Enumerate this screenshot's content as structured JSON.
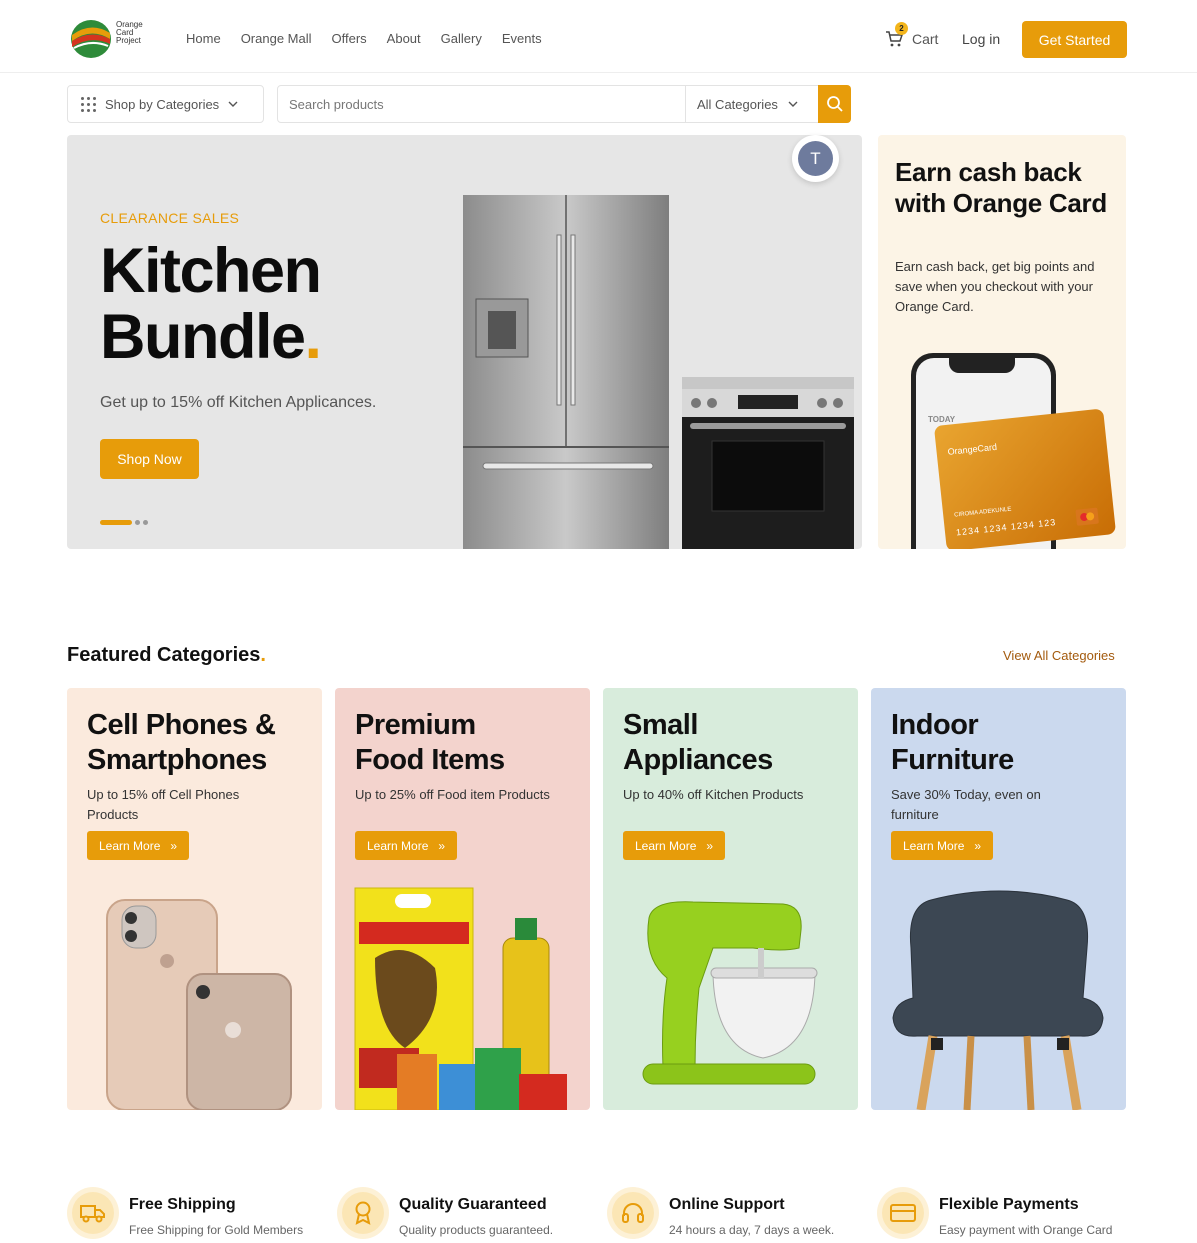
{
  "brand": {
    "logo_text": "Orange Card Project"
  },
  "nav": {
    "links": [
      "Home",
      "Orange Mall",
      "Offers",
      "About",
      "Gallery",
      "Events"
    ],
    "cart_label": "Cart",
    "cart_count": "2",
    "login_label": "Log in",
    "get_started_label": "Get Started"
  },
  "search": {
    "shop_by_categories": "Shop by Categories",
    "placeholder": "Search products",
    "category_select": "All Categories"
  },
  "hero": {
    "tag": "CLEARANCE SALES",
    "title_line1": "Kitchen",
    "title_line2": "Bundle",
    "title_dot": ".",
    "subtitle": "Get up to 15% off Kitchen Applicances.",
    "cta": "Shop Now",
    "avatar_initial": "T"
  },
  "promo": {
    "title": "Earn cash back with Orange Card",
    "text": "Earn cash back, get big points and save when you checkout with your Orange Card.",
    "card_brand": "OrangeCard",
    "card_holder": "CIROMA ADEKUNLE",
    "card_number": "1234 1234 1234 123",
    "phone_label": "TODAY"
  },
  "featured": {
    "title": "Featured Categories",
    "title_dot": ".",
    "view_all": "View All Categories",
    "learn_more": "Learn More",
    "categories": [
      {
        "title": "Cell Phones & Smartphones",
        "desc": "Up to 15% off Cell Phones Products",
        "bg": "#fbeadd"
      },
      {
        "title": "Premium Food Items",
        "desc": "Up to 25% off Food item Products",
        "bg": "#f3d3cd"
      },
      {
        "title": "Small Appliances",
        "desc": "Up to 40% off Kitchen Products",
        "bg": "#d8ecdc"
      },
      {
        "title": "Indoor Furniture",
        "desc": "Save 30% Today, even on furniture",
        "bg": "#cbd9ee"
      }
    ]
  },
  "features": [
    {
      "title": "Free Shipping",
      "sub": "Free Shipping for Gold Members",
      "icon": "truck-icon"
    },
    {
      "title": "Quality Guaranteed",
      "sub": "Quality products guaranteed.",
      "icon": "award-icon"
    },
    {
      "title": "Online Support",
      "sub": "24 hours a day, 7 days a week.",
      "icon": "headphones-icon"
    },
    {
      "title": "Flexible Payments",
      "sub": "Easy payment with Orange Card",
      "icon": "credit-card-icon"
    }
  ],
  "colors": {
    "accent": "#e79c0a",
    "hero_bg": "#e6e6e6",
    "promo_bg": "#fcf4e6"
  }
}
